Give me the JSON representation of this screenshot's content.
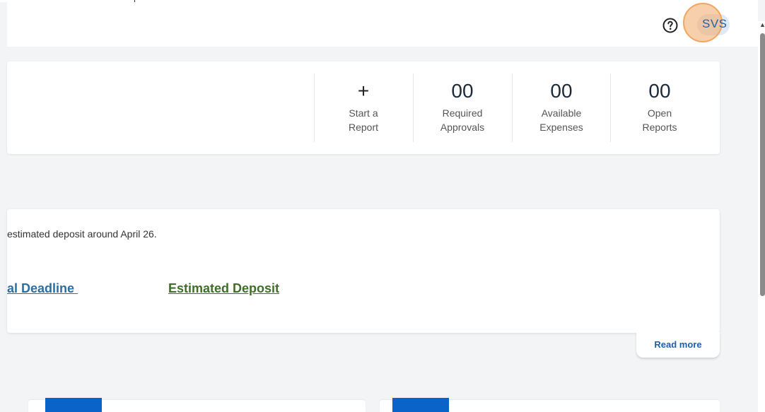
{
  "header": {
    "help_icon": "help-circle-icon",
    "avatar_initials": "SVS"
  },
  "stats": [
    {
      "value": "+",
      "label_line1": "Start a",
      "label_line2": "Report"
    },
    {
      "value": "00",
      "label_line1": "Required",
      "label_line2": "Approvals"
    },
    {
      "value": "00",
      "label_line1": "Available",
      "label_line2": "Expenses"
    },
    {
      "value": "00",
      "label_line1": "Open",
      "label_line2": "Reports"
    }
  ],
  "notice": {
    "text": "estimated deposit around April 26.",
    "deadline_link": "al Deadline ",
    "deposit_link": "Estimated Deposit",
    "read_more": "Read more"
  },
  "colors": {
    "accent_blue": "#0a63c9",
    "deadline_link": "#2d6e9e",
    "deposit_link": "#3f6e2a",
    "avatar_highlight": "#f0a660"
  }
}
